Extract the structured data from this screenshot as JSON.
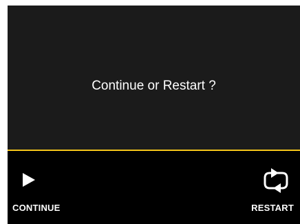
{
  "dialog": {
    "prompt": "Continue or Restart ?"
  },
  "softkeys": {
    "continue": {
      "label": "CONTINUE",
      "icon": "play-icon"
    },
    "restart": {
      "label": "RESTART",
      "icon": "restart-icon"
    }
  },
  "colors": {
    "screen_background": "#000000",
    "dialog_background": "#1b1b1b",
    "divider": "#f5c51a",
    "text": "#ffffff"
  }
}
